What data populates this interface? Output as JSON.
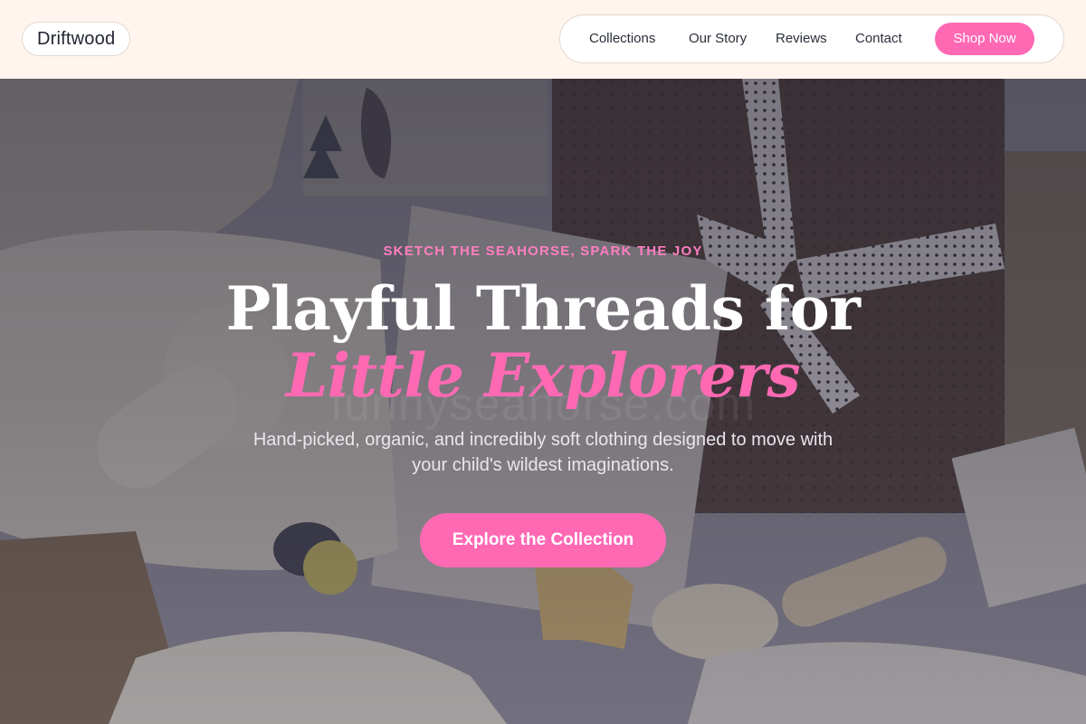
{
  "brand": {
    "name": "Driftwood"
  },
  "nav": {
    "links": [
      "Collections",
      "Our Story",
      "Reviews",
      "Contact"
    ],
    "cta_label": "Shop Now"
  },
  "hero": {
    "eyebrow": "SKETCH THE SEAHORSE, SPARK THE JOY",
    "title_line1": "Playful Threads for",
    "title_line2": "Little Explorers",
    "watermark": "funnyseahorse.com",
    "subtitle": "Hand-picked, organic, and incredibly soft clothing designed to move with your child's wildest imaginations.",
    "cta_label": "Explore the Collection"
  },
  "colors": {
    "accent": "#ff69b4",
    "header_bg": "#fff4ee",
    "heading": "#ffffff"
  }
}
